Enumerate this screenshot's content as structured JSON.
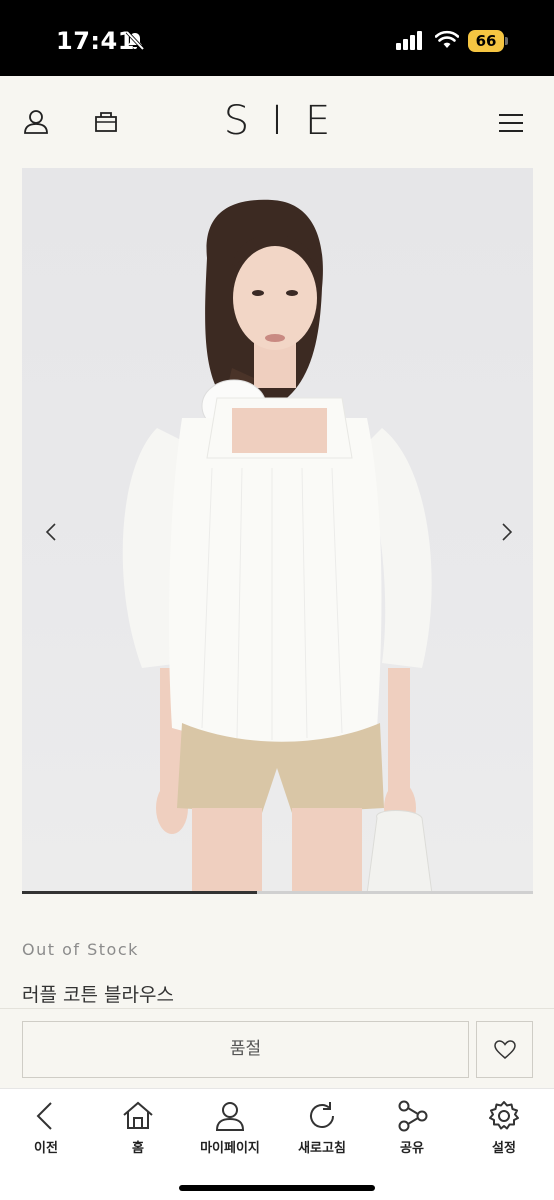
{
  "status_bar": {
    "time": "17:41",
    "battery_level": "66",
    "icons": [
      "bell-slash-icon",
      "signal-icon",
      "wifi-icon",
      "battery-icon"
    ]
  },
  "header": {
    "brand": "SIE",
    "icons": [
      "user-icon",
      "shopping-bag-icon",
      "menu-icon"
    ]
  },
  "product": {
    "image_alt": "Model wearing white ruffle cotton blouse",
    "stock_status": "Out of Stock",
    "name": "러플 코튼 블라우스",
    "gallery_progress": 0.46
  },
  "actions": {
    "soldout_label": "품절",
    "wishlist_icon": "heart-icon"
  },
  "toolbar": {
    "items": [
      {
        "label": "이전",
        "icon": "back-icon"
      },
      {
        "label": "홈",
        "icon": "home-icon"
      },
      {
        "label": "마이페이지",
        "icon": "user-icon"
      },
      {
        "label": "새로고침",
        "icon": "refresh-icon"
      },
      {
        "label": "공유",
        "icon": "share-icon"
      },
      {
        "label": "설정",
        "icon": "settings-icon"
      }
    ]
  },
  "colors": {
    "background": "#f7f6f1",
    "text": "#333333",
    "muted": "#8c8c8c",
    "battery": "#f5c542"
  }
}
